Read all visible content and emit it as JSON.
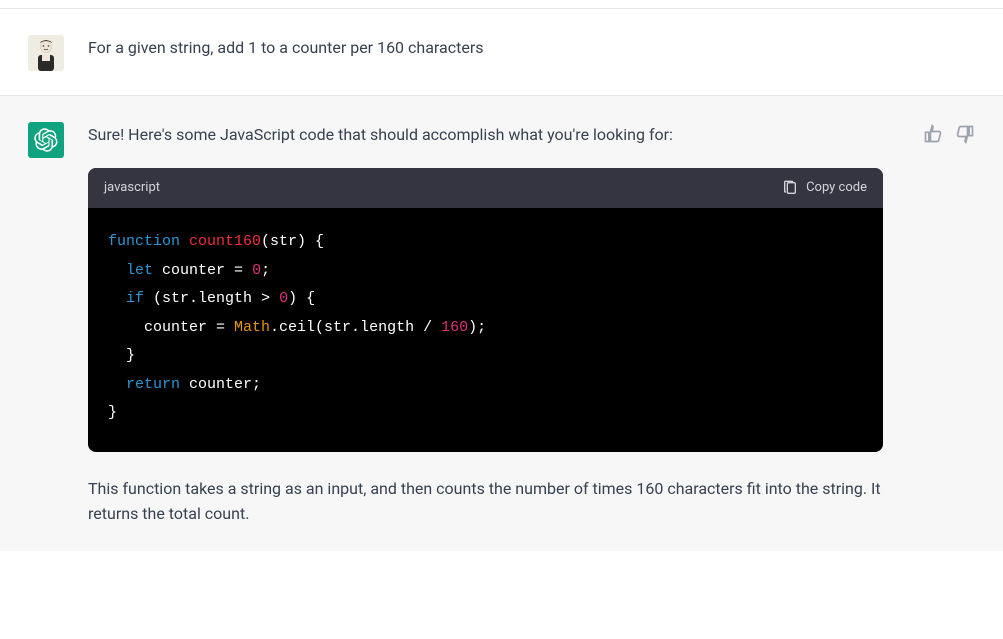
{
  "user_message": "For a given string, add 1 to a counter per 160 characters",
  "assistant_intro": "Sure! Here's some JavaScript code that should accomplish what you're looking for:",
  "assistant_explain": "This function takes a string as an input, and then counts the number of times 160 characters fit into the string. It returns the total count.",
  "codeblock": {
    "language": "javascript",
    "copy_label": "Copy code",
    "code": {
      "kw_function": "function",
      "fn_name": "count160",
      "params": "(str) {",
      "kw_let": "let",
      "var_counter": " counter = ",
      "num_zero": "0",
      "kw_if": "if",
      "cond_open": " (str.length > ",
      "cond_close": ") {",
      "assign": "    counter = ",
      "builtin_math": "Math",
      "ceil_call": ".ceil(str.length / ",
      "num_160": "160",
      "ceil_close": ");",
      "close_if": "  }",
      "kw_return": "return",
      "return_tail": " counter;",
      "close_fn": "}"
    }
  }
}
